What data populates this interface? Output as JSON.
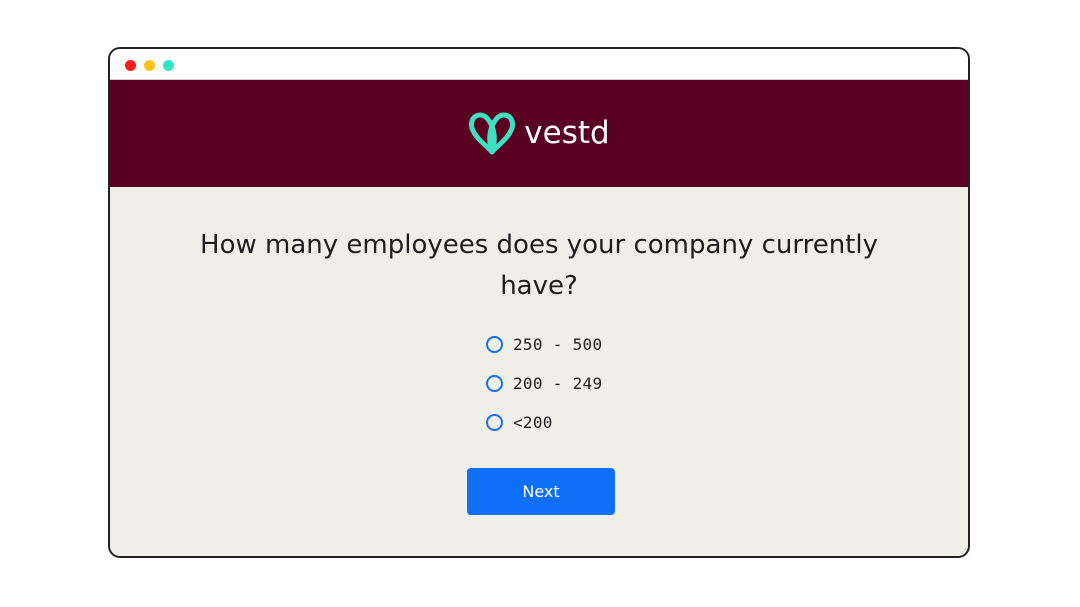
{
  "brand": {
    "name": "vestd",
    "logo_icon": "vestd-v-logo-icon",
    "logo_color": "#3ee0c0",
    "header_color": "#5a0023"
  },
  "window": {
    "controls": [
      "close-dot",
      "minimize-dot",
      "maximize-dot"
    ]
  },
  "survey": {
    "question": "How many employees does your company currently have?",
    "options": [
      {
        "label": "250 - 500",
        "selected": false
      },
      {
        "label": "200 - 249",
        "selected": false
      },
      {
        "label": "<200",
        "selected": false
      }
    ],
    "next_label": "Next",
    "accent_color": "#0f6ff8"
  }
}
